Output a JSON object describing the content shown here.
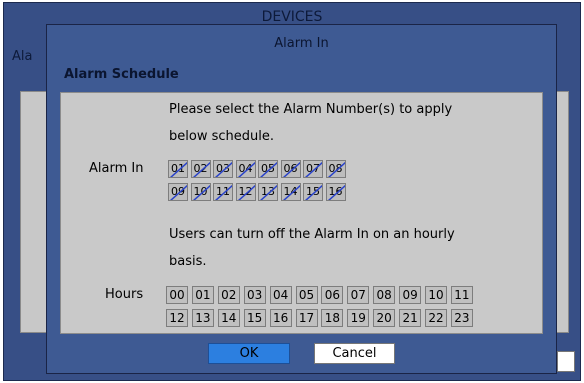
{
  "background": {
    "title": "DEVICES",
    "left_label": "Ala"
  },
  "dialog": {
    "title": "Alarm In",
    "section": "Alarm Schedule",
    "instruction_line1": "Please select the Alarm Number(s) to apply",
    "instruction_line2": "below schedule.",
    "alarm_label": "Alarm In",
    "alarms_row1": [
      "01",
      "02",
      "03",
      "04",
      "05",
      "06",
      "07",
      "08"
    ],
    "alarms_row2": [
      "09",
      "10",
      "11",
      "12",
      "13",
      "14",
      "15",
      "16"
    ],
    "hourly_line1": "Users can turn off the Alarm In on an hourly",
    "hourly_line2": "basis.",
    "hours_label": "Hours",
    "hours_row1": [
      "00",
      "01",
      "02",
      "03",
      "04",
      "05",
      "06",
      "07",
      "08",
      "09",
      "10",
      "11"
    ],
    "hours_row2": [
      "12",
      "13",
      "14",
      "15",
      "16",
      "17",
      "18",
      "19",
      "20",
      "21",
      "22",
      "23"
    ],
    "ok_label": "OK",
    "cancel_label": "Cancel"
  },
  "colors": {
    "dialog_bg": "#3e5a93",
    "panel_bg": "#c9c9c9",
    "ok_button": "#2c7fe0",
    "slash": "#2a43c9"
  }
}
